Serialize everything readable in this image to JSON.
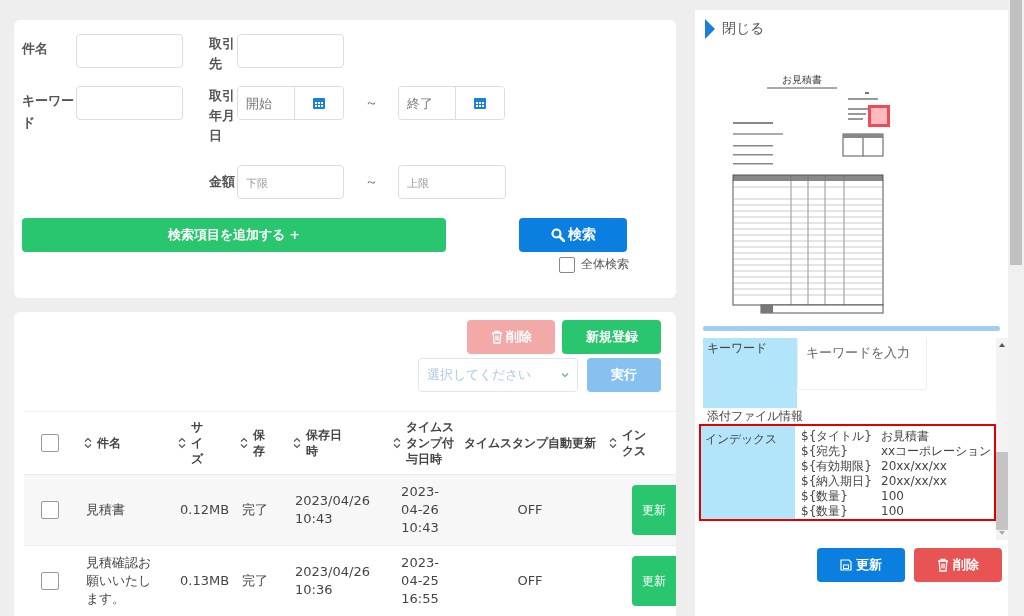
{
  "search_form": {
    "subject": {
      "label": "件名"
    },
    "partner": {
      "label": "取引先"
    },
    "keyword": {
      "label": "キーワード"
    },
    "date": {
      "label": "取引年月日",
      "from_placeholder": "開始",
      "separator": "～",
      "to_placeholder": "終了"
    },
    "amount": {
      "label": "金額",
      "from_placeholder": "下限",
      "separator": "～",
      "to_placeholder": "上限"
    },
    "add_button": "検索項目を追加する +",
    "search_button": "検索",
    "full_search": {
      "label": "全体検索",
      "checked": false
    }
  },
  "list": {
    "delete_button": {
      "label": "削除",
      "disabled": true
    },
    "new_button": {
      "label": "新規登録"
    },
    "action_select": {
      "placeholder": "選択してください"
    },
    "run_button": {
      "label": "実行",
      "disabled": true
    },
    "header_checked": false,
    "columns": [
      {
        "label": "件名",
        "sortable": true
      },
      {
        "label": "サイズ",
        "sortable": true
      },
      {
        "label": "保存",
        "sortable": true
      },
      {
        "label": "保存日時",
        "sortable": true
      },
      {
        "label": "タイムスタンプ付与日時",
        "sortable": true
      },
      {
        "label": "タイムスタンプ自動更新",
        "sortable": false
      },
      {
        "label": "インクス",
        "sortable": true
      }
    ],
    "rows": [
      {
        "checked": false,
        "cells": [
          "見積書",
          "0.12MB",
          "完了",
          "2023/04/26 10:43",
          "2023-04-26 10:43",
          "OFF"
        ],
        "button": "更新"
      },
      {
        "checked": false,
        "cells": [
          "見積確認お願いいたします。",
          "0.13MB",
          "完了",
          "2023/04/26 10:36",
          "2023-04-25 16:55",
          "OFF"
        ],
        "button": "更新"
      }
    ]
  },
  "detail": {
    "close": "閉じる",
    "preview": {
      "title": "お見積書"
    },
    "keyword": {
      "label": "キーワード",
      "placeholder": "キーワードを入力"
    },
    "attachment_label": "添付ファイル情報",
    "index": {
      "label": "インデックス",
      "highlighted": true,
      "entries": [
        {
          "key": "${タイトル}",
          "value": "お見積書"
        },
        {
          "key": "${宛先}",
          "value": "xxコーポレーション"
        },
        {
          "key": "${有効期限}",
          "value": "20xx/xx/xx"
        },
        {
          "key": "${納入期日}",
          "value": "20xx/xx/xx"
        },
        {
          "key": "${数量}",
          "value": "100"
        },
        {
          "key": "${数量}",
          "value": "100"
        }
      ]
    },
    "update_button": "更新",
    "delete_button": "削除"
  }
}
